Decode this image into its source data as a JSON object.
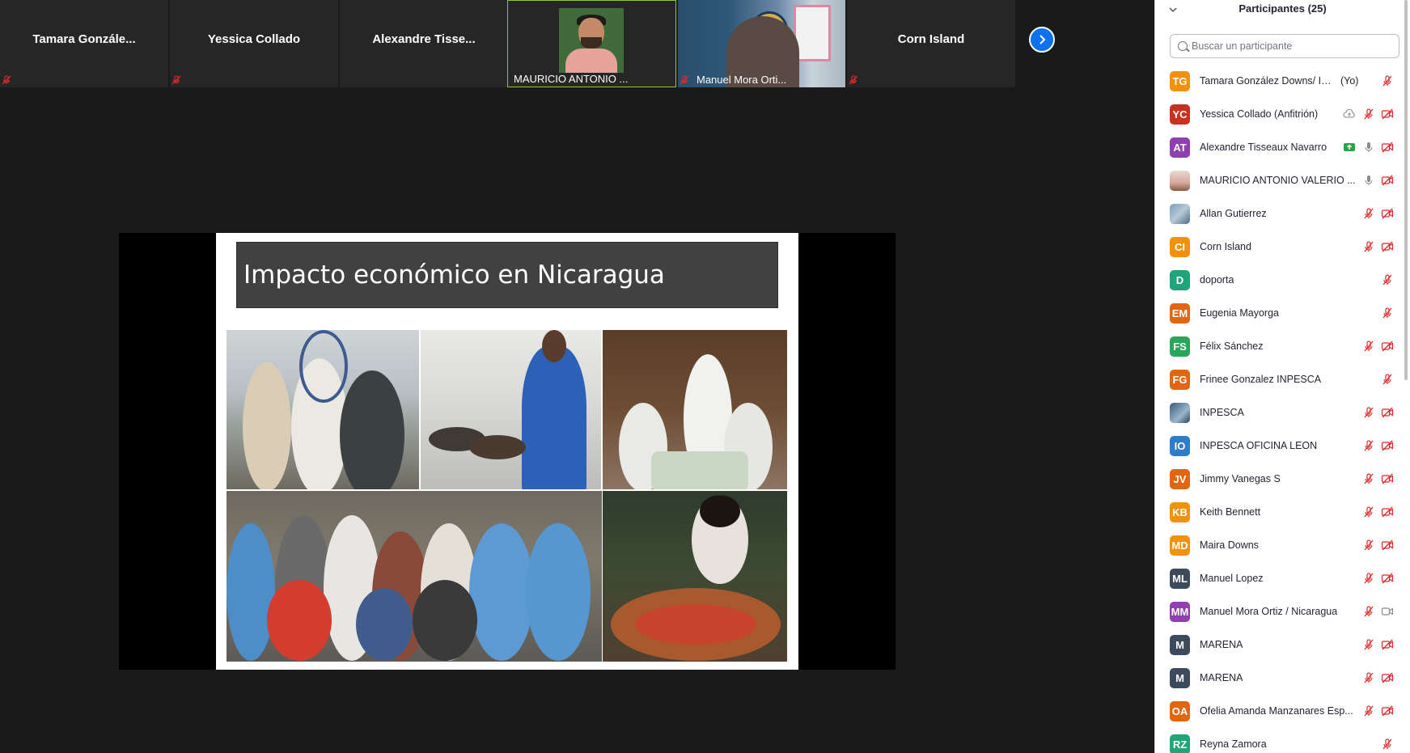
{
  "filmstrip": {
    "tiles": [
      {
        "name": "Tamara  Gonzále..."
      },
      {
        "name": "Yessica Collado"
      },
      {
        "name": "Alexandre  Tisse..."
      },
      {
        "name": "MAURICIO ANTONIO ..."
      },
      {
        "name": "Manuel Mora Orti..."
      },
      {
        "name": "Corn Island"
      }
    ],
    "next_icon": "chevron-right-icon"
  },
  "share": {
    "slide_title": "Impacto económico en Nicaragua"
  },
  "participants": {
    "title": "Participantes (25)",
    "search_placeholder": "Buscar un participante",
    "items": [
      {
        "initials": "TG",
        "name": "Tamara González Downs/ INPE...",
        "tag": "(Yo)",
        "color": "#f0920e",
        "mic": "muted",
        "video": "none"
      },
      {
        "initials": "YC",
        "name": "Yessica Collado (Anfitrión)",
        "tag": "",
        "color": "#c8301f",
        "mic": "muted",
        "video": "off",
        "extra": "cloud"
      },
      {
        "initials": "AT",
        "name": "Alexandre Tisseaux Navarro",
        "tag": "",
        "color": "#8f3fae",
        "mic": "on",
        "video": "off",
        "extra": "share"
      },
      {
        "initials": "",
        "name": "MAURICIO ANTONIO VALERIO ...",
        "tag": "",
        "color": "",
        "mic": "on",
        "video": "off"
      },
      {
        "initials": "",
        "name": "Allan Gutierrez",
        "tag": "",
        "color": "",
        "mic": "muted",
        "video": "off"
      },
      {
        "initials": "CI",
        "name": "Corn Island",
        "tag": "",
        "color": "#f0920e",
        "mic": "muted",
        "video": "off"
      },
      {
        "initials": "D",
        "name": "doporta",
        "tag": "",
        "color": "#22a47a",
        "mic": "muted",
        "video": "none"
      },
      {
        "initials": "EM",
        "name": "Eugenia Mayorga",
        "tag": "",
        "color": "#e0660f",
        "mic": "muted",
        "video": "none"
      },
      {
        "initials": "FS",
        "name": "Félix Sánchez",
        "tag": "",
        "color": "#2ba55a",
        "mic": "muted",
        "video": "off"
      },
      {
        "initials": "FG",
        "name": "Frinee Gonzalez INPESCA",
        "tag": "",
        "color": "#e0660f",
        "mic": "muted",
        "video": "none"
      },
      {
        "initials": "",
        "name": "INPESCA",
        "tag": "",
        "color": "",
        "mic": "muted",
        "video": "off"
      },
      {
        "initials": "IO",
        "name": "INPESCA OFICINA LEON",
        "tag": "",
        "color": "#2e7dc8",
        "mic": "muted",
        "video": "off"
      },
      {
        "initials": "JV",
        "name": "Jimmy Vanegas S",
        "tag": "",
        "color": "#e0660f",
        "mic": "muted",
        "video": "off"
      },
      {
        "initials": "KB",
        "name": "Keith Bennett",
        "tag": "",
        "color": "#f0920e",
        "mic": "muted",
        "video": "off"
      },
      {
        "initials": "MD",
        "name": "Maira Downs",
        "tag": "",
        "color": "#f0920e",
        "mic": "muted",
        "video": "off"
      },
      {
        "initials": "ML",
        "name": "Manuel Lopez",
        "tag": "",
        "color": "#3d4a5c",
        "mic": "muted",
        "video": "off"
      },
      {
        "initials": "MM",
        "name": "Manuel Mora Ortiz / Nicaragua",
        "tag": "",
        "color": "#8f3fae",
        "mic": "muted",
        "video": "on"
      },
      {
        "initials": "M",
        "name": "MARENA",
        "tag": "",
        "color": "#3d4a5c",
        "mic": "muted",
        "video": "off"
      },
      {
        "initials": "M",
        "name": "MARENA",
        "tag": "",
        "color": "#3d4a5c",
        "mic": "muted",
        "video": "off"
      },
      {
        "initials": "OA",
        "name": "Ofelia Amanda Manzanares Esp...",
        "tag": "",
        "color": "#e0660f",
        "mic": "muted",
        "video": "off"
      },
      {
        "initials": "RZ",
        "name": "Reyna Zamora",
        "tag": "",
        "color": "#22a47a",
        "mic": "muted",
        "video": "none"
      }
    ]
  },
  "colors": {
    "muted_red": "#e02828",
    "active_speaker_border": "#8dc63f",
    "accent_blue": "#0e72ed"
  }
}
